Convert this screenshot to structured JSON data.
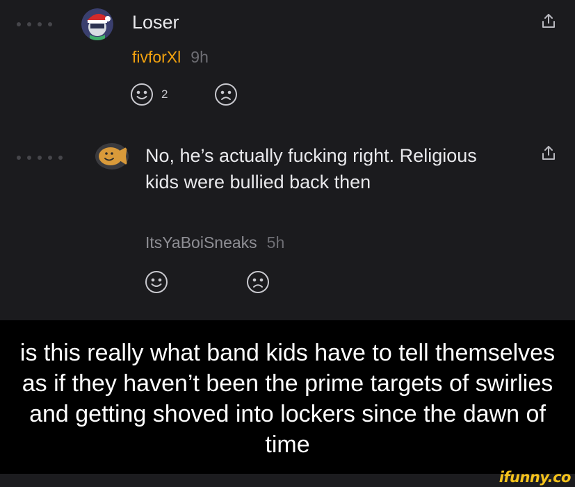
{
  "comments": [
    {
      "text": "Loser",
      "username": "fivforXl",
      "time": "9h",
      "like_count": "2",
      "username_color": "#f2a20f"
    },
    {
      "text": "No, he’s actually fucking right. Religious kids were bullied back then",
      "username": "ItsYaBoiSneaks",
      "time": "5h",
      "like_count": "",
      "username_color": "#8f8f95"
    }
  ],
  "caption": "is this really what band kids have to tell themselves as if they haven’t been the prime targets of swirlies and getting shoved into lockers since the dawn of time",
  "watermark": "ifunny.co",
  "icons": [
    "share-icon",
    "smile-icon",
    "frown-icon"
  ],
  "colors": {
    "background": "#1b1b1e",
    "accent": "#f5c31b"
  }
}
